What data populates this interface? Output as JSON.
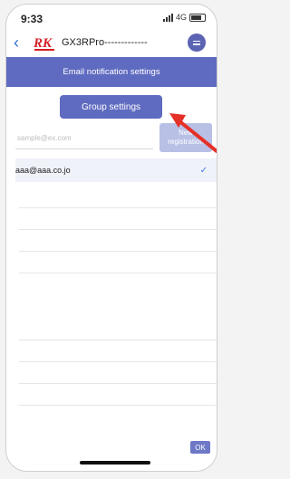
{
  "status_bar": {
    "time": "9:33",
    "network": "4G"
  },
  "app_header": {
    "back_icon": "chevron-left-icon",
    "logo_icon": "rk-logo-icon",
    "app_name": "GX3RPro-------------",
    "menu_icon": "menu-icon"
  },
  "title_bar": {
    "title": "Email notification settings"
  },
  "group_settings": {
    "label": "Group settings"
  },
  "email_entry": {
    "placeholder": "sample@ex.com",
    "value": ""
  },
  "new_registration": {
    "label_line1": "New",
    "label_line2": "registration"
  },
  "email_list": [
    {
      "address": "aaa@aaa.co.jo",
      "checked": true
    }
  ],
  "ok_button": {
    "label": "OK"
  },
  "colors": {
    "primary": "#5f6bc0",
    "primary_disabled": "#b9c0e6",
    "check": "#3b7be0",
    "annotation_arrow": "#e53027"
  }
}
